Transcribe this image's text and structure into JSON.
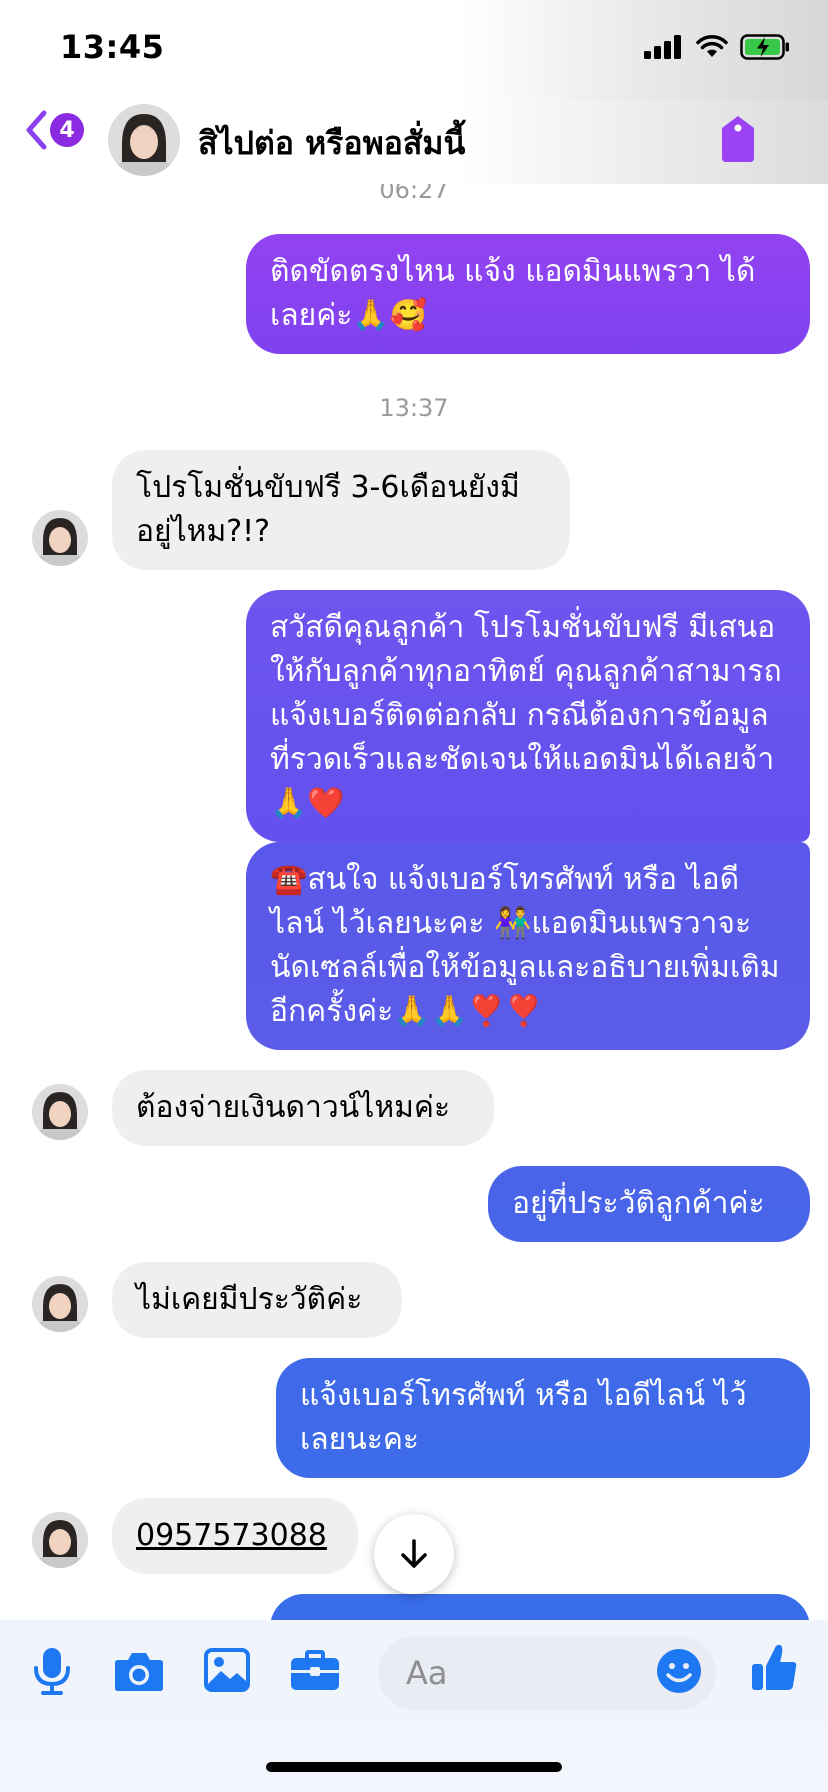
{
  "status": {
    "time": "13:45"
  },
  "header": {
    "back_count": "4",
    "contact_name": "สิไปต่อ หรือพอสั่มนี้"
  },
  "messages": {
    "ts_top": "06:27",
    "m1": "ติดขัดตรงไหน แจ้ง แอดมินแพรวา ได้เลยค่ะ🙏🥰",
    "ts_mid": "13:37",
    "m2": "โปรโมชั่นขับฟรี 3-6เดือนยังมีอยู่ไหม?!?",
    "m3": "สวัสดีคุณลูกค้า โปรโมชั่นขับฟรี มีเสนอให้กับลูกค้าทุกอาทิตย์ คุณลูกค้าสามารถแจ้งเบอร์ติดต่อกลับ กรณีต้องการข้อมูลที่รวดเร็วและชัดเจนให้แอดมินได้เลยจ้า🙏❤️",
    "m4": "☎️สนใจ แจ้งเบอร์โทรศัพท์ หรือ ไอดีไลน์  ไว้เลยนะคะ 👫แอดมินแพรวาจะนัดเซลล์เพื่อให้ข้อมูลและอธิบายเพิ่มเติมอีกครั้งค่ะ🙏🙏❣️❣️",
    "m5": "ต้องจ่ายเงินดาวน์ไหมค่ะ",
    "m6": "อยู่ที่ประวัติลูกค้าค่ะ",
    "m7": "ไม่เคยมีประวัติค่ะ",
    "m8": "แจ้งเบอร์โทรศัพท์ หรือ ไอดีไลน์  ไว้เลยนะคะ",
    "m9": "0957573088"
  },
  "composer": {
    "placeholder": "Aa",
    "icons": [
      "microphone-icon",
      "camera-icon",
      "gallery-icon",
      "toolbox-icon",
      "emoji-icon",
      "like-icon"
    ]
  },
  "colors": {
    "accent_purple": "#8a3ff0",
    "outgoing_gradient": [
      "#8a3ff0",
      "#5f5ae8",
      "#3e69ea"
    ],
    "incoming_bg": "#efefef",
    "composer_icon": "#1d78f2"
  }
}
